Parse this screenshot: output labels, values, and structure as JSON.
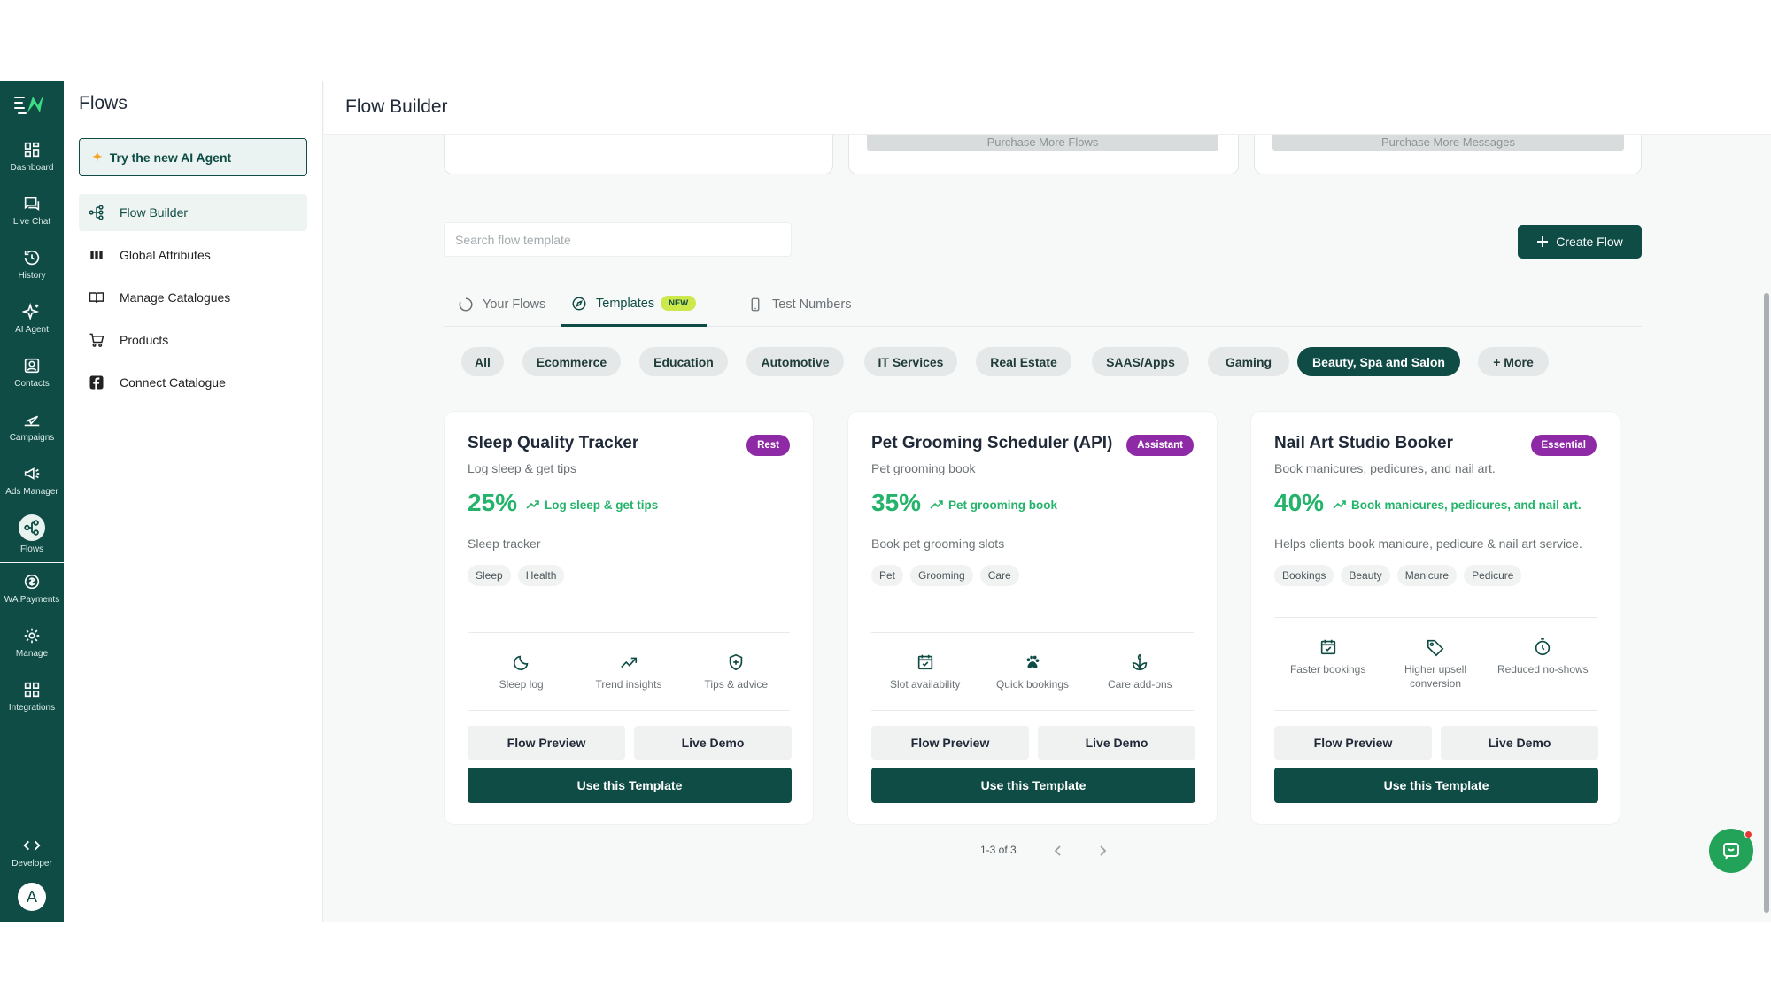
{
  "rail": {
    "items": [
      {
        "label": "Dashboard",
        "icon": "dashboard-icon"
      },
      {
        "label": "Live Chat",
        "icon": "chat-icon"
      },
      {
        "label": "History",
        "icon": "history-icon"
      },
      {
        "label": "AI Agent",
        "icon": "sparkles-icon"
      },
      {
        "label": "Contacts",
        "icon": "contacts-icon"
      },
      {
        "label": "Campaigns",
        "icon": "send-icon"
      },
      {
        "label": "Ads Manager",
        "icon": "megaphone-icon"
      },
      {
        "label": "Flows",
        "icon": "flows-icon"
      },
      {
        "label": "WA Payments",
        "icon": "payment-icon"
      },
      {
        "label": "Manage",
        "icon": "gear-icon"
      },
      {
        "label": "Integrations",
        "icon": "integrations-icon"
      },
      {
        "label": "Developer",
        "icon": "code-icon"
      }
    ],
    "active": "Flows",
    "avatar_letter": "A"
  },
  "side": {
    "title": "Flows",
    "ai_button": "Try the new AI Agent",
    "items": [
      {
        "label": "Flow Builder",
        "icon": "flow-icon"
      },
      {
        "label": "Global Attributes",
        "icon": "columns-icon"
      },
      {
        "label": "Manage Catalogues",
        "icon": "book-icon"
      },
      {
        "label": "Products",
        "icon": "cart-icon"
      },
      {
        "label": "Connect Catalogue",
        "icon": "facebook-icon"
      }
    ]
  },
  "main": {
    "title": "Flow Builder",
    "purchase_flows": "Purchase More Flows",
    "purchase_messages": "Purchase More Messages",
    "search_placeholder": "Search flow template",
    "create_button": "Create Flow",
    "tabs": [
      {
        "label": "Your Flows"
      },
      {
        "label": "Templates",
        "badge": "NEW"
      },
      {
        "label": "Test Numbers"
      }
    ],
    "active_tab": "Templates",
    "categories": [
      "All",
      "Ecommerce",
      "Education",
      "Automotive",
      "IT Services",
      "Real Estate",
      "SAAS/Apps",
      "Gaming",
      "Beauty, Spa and Salon",
      "+ More"
    ],
    "active_category": "Beauty, Spa and Salon",
    "cards": [
      {
        "title": "Sleep Quality Tracker",
        "badge": "Rest",
        "subtitle": "Log sleep & get tips",
        "percent": "25%",
        "trend": "Log sleep & get tips",
        "desc": "Sleep tracker",
        "tags": [
          "Sleep",
          "Health"
        ],
        "features": [
          {
            "label": "Sleep log",
            "icon": "moon-icon"
          },
          {
            "label": "Trend insights",
            "icon": "trend-icon"
          },
          {
            "label": "Tips & advice",
            "icon": "shield-icon"
          }
        ]
      },
      {
        "title": "Pet Grooming Scheduler (API)",
        "badge": "Assistant",
        "subtitle": "Pet grooming book",
        "percent": "35%",
        "trend": "Pet grooming book",
        "desc": "Book pet grooming slots",
        "tags": [
          "Pet",
          "Grooming",
          "Care"
        ],
        "features": [
          {
            "label": "Slot availability",
            "icon": "calendar-check-icon"
          },
          {
            "label": "Quick bookings",
            "icon": "paw-icon"
          },
          {
            "label": "Care add-ons",
            "icon": "leaf-icon"
          }
        ]
      },
      {
        "title": "Nail Art Studio Booker",
        "badge": "Essential",
        "subtitle": "Book manicures, pedicures, and nail art.",
        "percent": "40%",
        "trend": "Book manicures, pedicures, and nail art.",
        "desc": "Helps clients book manicure, pedicure & nail art service.",
        "tags": [
          "Bookings",
          "Beauty",
          "Manicure",
          "Pedicure"
        ],
        "features": [
          {
            "label": "Faster bookings",
            "icon": "calendar-check-icon"
          },
          {
            "label": "Higher upsell conversion",
            "icon": "tag-icon"
          },
          {
            "label": "Reduced no-shows",
            "icon": "timer-icon"
          }
        ]
      }
    ],
    "flow_preview": "Flow Preview",
    "live_demo": "Live Demo",
    "use_template": "Use this Template",
    "pagination": "1-3 of 3"
  },
  "colors": {
    "brand": "#0f4c45",
    "accent_green": "#23b36a",
    "badge_purple": "#8e2aa6",
    "new_badge": "#cde84b"
  }
}
